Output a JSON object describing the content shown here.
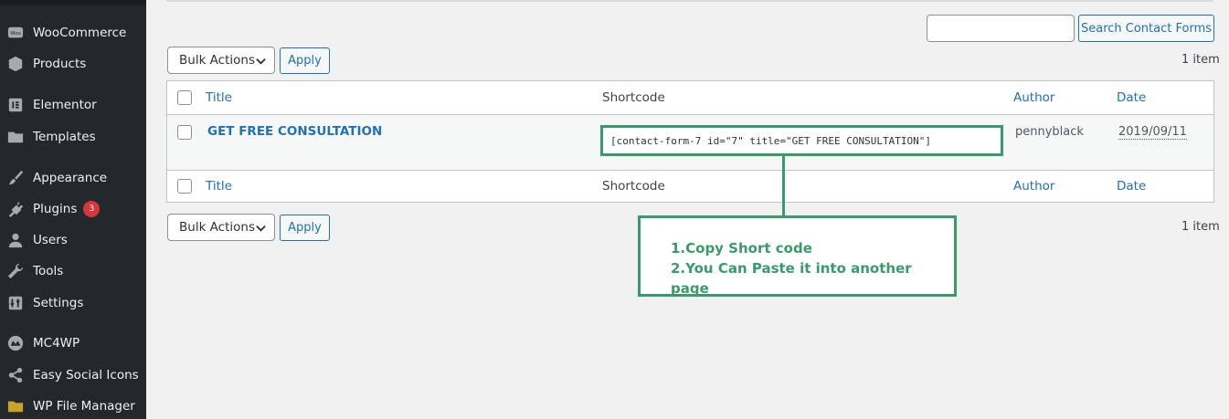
{
  "sidebar": {
    "items": [
      {
        "label": "WooCommerce",
        "icon": "woocommerce-icon"
      },
      {
        "label": "Products",
        "icon": "products-icon"
      },
      {
        "label": "Elementor",
        "icon": "elementor-icon"
      },
      {
        "label": "Templates",
        "icon": "folder-icon"
      },
      {
        "label": "Appearance",
        "icon": "brush-icon"
      },
      {
        "label": "Plugins",
        "icon": "plugin-icon",
        "badge": "3"
      },
      {
        "label": "Users",
        "icon": "user-icon"
      },
      {
        "label": "Tools",
        "icon": "wrench-icon"
      },
      {
        "label": "Settings",
        "icon": "settings-icon"
      },
      {
        "label": "MC4WP",
        "icon": "mc4wp-icon"
      },
      {
        "label": "Easy Social Icons",
        "icon": "share-icon"
      },
      {
        "label": "WP File Manager",
        "icon": "folder-icon"
      }
    ]
  },
  "search": {
    "value": "",
    "button_label": "Search Contact Forms"
  },
  "bulk": {
    "top": "Bulk Actions",
    "bottom": "Bulk Actions",
    "apply_label": "Apply"
  },
  "count": {
    "top": "1 item",
    "bottom": "1 item"
  },
  "table": {
    "columns": {
      "title": "Title",
      "shortcode": "Shortcode",
      "author": "Author",
      "date": "Date"
    },
    "row": {
      "title": "GET FREE CONSULTATION",
      "shortcode": "[contact-form-7 id=\"7\" title=\"GET FREE CONSULTATION\"]",
      "author": "pennyblack",
      "date": "2019/09/11"
    }
  },
  "annotation": {
    "line1": "1.Copy Short code",
    "line2": "2.You Can Paste it into another page"
  },
  "colors": {
    "accent": "#2271b1",
    "annotation": "#3a9a6c",
    "sidebar": "#23282d"
  }
}
